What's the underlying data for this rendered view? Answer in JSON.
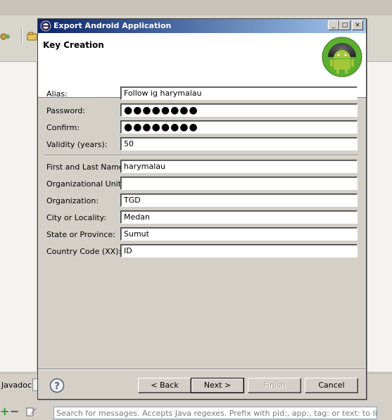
{
  "ide": {
    "javadoc_tab": "Javadoc",
    "logcat_search_placeholder": "Search for messages. Accepts Java regexes. Prefix with pid:, app:, tag: or text: to limit scope."
  },
  "dialog": {
    "title": "Export Android Application",
    "window_buttons": {
      "minimize": "_",
      "maximize": "□",
      "close": "×"
    },
    "banner_title": "Key Creation",
    "fields": {
      "alias": {
        "label": "Alias:",
        "value": "Follow ig harymalau"
      },
      "password": {
        "label": "Password:",
        "value": "●●●●●●●●"
      },
      "confirm": {
        "label": "Confirm:",
        "value": "●●●●●●●●"
      },
      "validity": {
        "label": "Validity (years):",
        "value": "50"
      },
      "name": {
        "label": "First and Last Name:",
        "value": "harymalau"
      },
      "org_unit": {
        "label": "Organizational Unit:",
        "value": ""
      },
      "organization": {
        "label": "Organization:",
        "value": "TGD"
      },
      "city": {
        "label": "City or Locality:",
        "value": "Medan"
      },
      "state": {
        "label": "State or Province:",
        "value": "Sumut"
      },
      "country": {
        "label": "Country Code (XX):",
        "value": "ID"
      }
    },
    "buttons": {
      "back": "< Back",
      "next": "Next >",
      "finish": "Finish",
      "cancel": "Cancel"
    }
  },
  "colors": {
    "title_gradient_start": "#0a246a",
    "title_gradient_end": "#a6caf0",
    "android_green": "#8bc34a"
  }
}
